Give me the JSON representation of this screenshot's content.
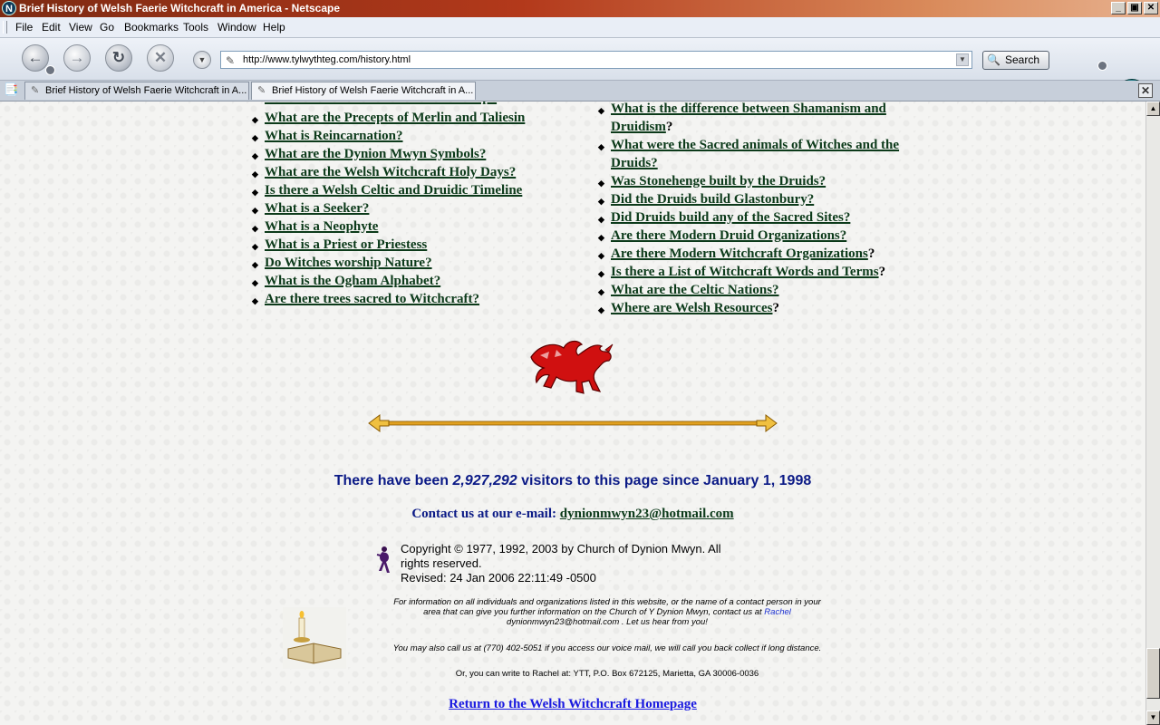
{
  "window": {
    "title": "Brief History of Welsh Faerie Witchcraft in America - Netscape",
    "app_icon": "N",
    "controls": [
      "_",
      "▣",
      "✕"
    ]
  },
  "menu": [
    "File",
    "Edit",
    "View",
    "Go",
    "Bookmarks",
    "Tools",
    "Window",
    "Help"
  ],
  "toolbar": {
    "url": "http://www.tylwythteg.com/history.html",
    "search_label": "Search",
    "logo": "N"
  },
  "tabs": [
    {
      "label": "Brief History of Welsh Faerie Witchcraft in A...",
      "active": false
    },
    {
      "label": "Brief History of Welsh Faerie Witchcraft in A...",
      "active": true
    }
  ],
  "left_questions": [
    "What are the Precepts of Merlin and Taliesin",
    "What is Reincarnation?",
    "What are the Dynion Mwyn Symbols?",
    "What are the Welsh Witchcraft Holy Days?",
    "Is there a Welsh Celtic and Druidic Timeline",
    "What is a Seeker?",
    "What is a Neophyte",
    "What is a Priest or Priestess",
    "Do Witches worship Nature?",
    "What is the Ogham Alphabet?",
    "Are there trees sacred to Witchcraft?"
  ],
  "right_questions": [
    {
      "line1": "What is the difference between Shamanism and",
      "line2": "Druidism",
      "suffix": "?"
    },
    {
      "line1": "What were the Sacred animals of Witches and the",
      "line2": "Druids?",
      "suffix": ""
    },
    {
      "line1": "Was Stonehenge built by the Druids?",
      "suffix": ""
    },
    {
      "line1": "Did the Druids build Glastonbury?",
      "suffix": ""
    },
    {
      "line1": "Did Druids build any of the Sacred Sites?",
      "suffix": ""
    },
    {
      "line1": "Are there Modern Druid Organizations?",
      "suffix": ""
    },
    {
      "line1": "Are there Modern Witchcraft Organizations",
      "suffix": "?"
    },
    {
      "line1": "Is there a List of Witchcraft Words and Terms",
      "suffix": "?"
    },
    {
      "line1": "What are the Celtic Nations?",
      "suffix": ""
    },
    {
      "line1": "Where are Welsh Resources",
      "suffix": "?"
    }
  ],
  "counter": {
    "prefix": "There have been ",
    "count": "2,927,292",
    "suffix": " visitors to this page since January 1, 1998"
  },
  "contact": {
    "label": "Contact us at our e-mail: ",
    "email": "dynionmwyn23@hotmail.com"
  },
  "copyright": {
    "line1": "Copyright © 1977, 1992, 2003 by Church of Dynion Mwyn.   All",
    "line2": "rights reserved.",
    "line3": "Revised: 24 Jan 2006 22:11:49 -0500"
  },
  "info": {
    "p1a": "For information on all individuals and organizations listed in this website, or the name of a contact person in your",
    "p1b": "area that can give you further information on the Church of Y Dynion Mwyn, contact us at ",
    "p1_link": "Rachel",
    "p1c": "dynionmwyn23@hotmail.com . Let us hear from you!",
    "p2": "You may also call us at (770) 402-5051 if you access our voice mail, we will call you back collect if long distance.",
    "p3": "Or, you can write to Rachel at: YTT, P.O. Box 672125, Marietta, GA 30006-0036"
  },
  "return_link": "Return to the Welsh Witchcraft Homepage",
  "colors": {
    "link_green": "#0c3a1a",
    "counter_blue": "#0b1a86",
    "return_blue": "#1a1ae0",
    "dragon_red": "#d01010",
    "title_bar": "#b3391b"
  }
}
